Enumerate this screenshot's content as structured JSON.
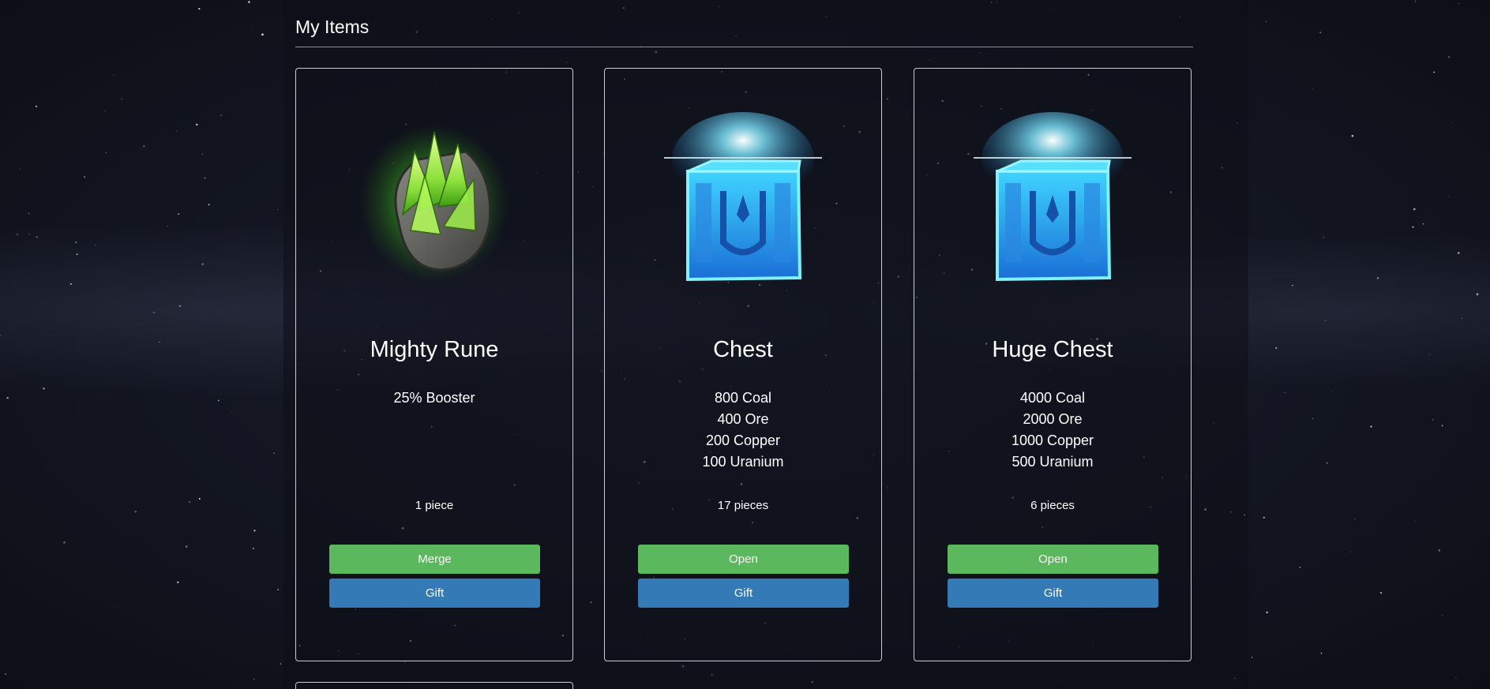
{
  "page": {
    "heading": "My Items"
  },
  "items": [
    {
      "name": "Mighty Rune",
      "icon": "green-crystal-rune-icon",
      "contents": [
        "25% Booster"
      ],
      "count": "1 piece",
      "primary_action": "Merge",
      "gift_action": "Gift"
    },
    {
      "name": "Chest",
      "icon": "blue-glowing-chest-icon",
      "contents": [
        "800 Coal",
        "400 Ore",
        "200 Copper",
        "100 Uranium"
      ],
      "count": "17 pieces",
      "primary_action": "Open",
      "gift_action": "Gift"
    },
    {
      "name": "Huge Chest",
      "icon": "blue-glowing-chest-icon",
      "contents": [
        "4000 Coal",
        "2000 Ore",
        "1000 Copper",
        "500 Uranium"
      ],
      "count": "6 pieces",
      "primary_action": "Open",
      "gift_action": "Gift"
    }
  ],
  "colors": {
    "primary_button": "#5cb85c",
    "gift_button": "#337ab7",
    "card_border": "#c9ccd2"
  }
}
